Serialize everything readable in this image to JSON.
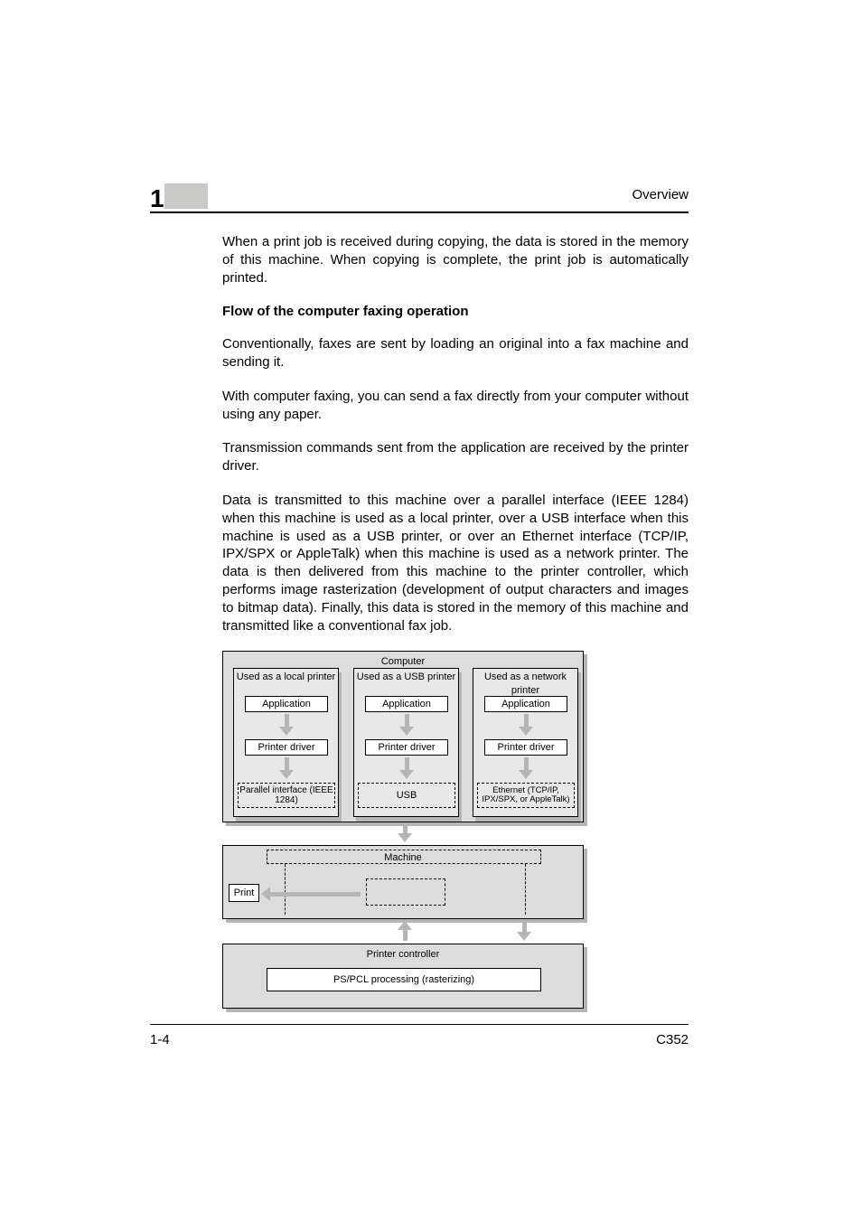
{
  "header": {
    "chapter_number": "1",
    "section_label": "Overview"
  },
  "body": {
    "intro_para": "When a print job is received during copying, the data is stored in the memory of this machine. When copying is complete, the print job is automatically printed.",
    "heading": "Flow of the computer faxing operation",
    "para1": "Conventionally, faxes are sent by loading an original into a fax machine and sending it.",
    "para2": "With computer faxing, you can send a fax directly from your computer without using any paper.",
    "para3": "Transmission commands sent from the application are received by the printer driver.",
    "para4": "Data is transmitted to this machine over a parallel interface (IEEE 1284) when this machine is used as a local printer, over a USB interface when this machine is used as a USB printer, or over an Ethernet interface (TCP/IP, IPX/SPX or AppleTalk) when this machine is used as a network printer. The data is then delivered from this machine to the printer controller, which performs image rasterization (development of output characters and images to bitmap data). Finally, this data is stored in the memory of this machine and transmitted like a conventional fax job."
  },
  "diagram": {
    "computer_label": "Computer",
    "col1": {
      "used_as": "Used as a local printer",
      "application": "Application",
      "driver": "Printer driver",
      "interface": "Parallel interface (IEEE 1284)"
    },
    "col2": {
      "used_as": "Used as a USB printer",
      "application": "Application",
      "driver": "Printer driver",
      "interface": "USB"
    },
    "col3": {
      "used_as": "Used as a network printer",
      "application": "Application",
      "driver": "Printer driver",
      "interface": "Ethernet (TCP/IP, IPX/SPX, or AppleTalk)"
    },
    "machine_label": "Machine",
    "print_label": "Print",
    "controller_label": "Printer controller",
    "processing_label": "PS/PCL processing (rasterizing)"
  },
  "footer": {
    "page": "1-4",
    "model": "C352"
  }
}
